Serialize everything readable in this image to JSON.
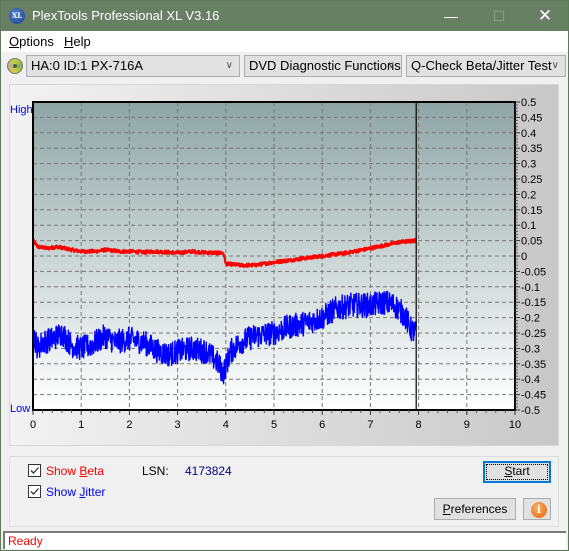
{
  "window": {
    "title": "PlexTools Professional XL V3.16",
    "app_icon_text": "XL",
    "minimize_glyph": "—",
    "maximize_glyph": "☐",
    "close_glyph": "✕"
  },
  "menu": [
    {
      "label_pre": "",
      "accel": "O",
      "label_post": "ptions"
    },
    {
      "label_pre": "",
      "accel": "H",
      "label_post": "elp"
    }
  ],
  "toolbar": {
    "drive": "HA:0 ID:1  PX-716A",
    "function": "DVD Diagnostic Functions",
    "test": "Q-Check Beta/Jitter Test",
    "chevron": "∨"
  },
  "chart_data": {
    "type": "line",
    "title": "",
    "xlabel": "",
    "ylabel_left_high": "High",
    "ylabel_left_low": "Low",
    "xlim": [
      0,
      10
    ],
    "ylim": [
      -0.5,
      0.5
    ],
    "x_ticks": [
      "0",
      "1",
      "2",
      "3",
      "4",
      "5",
      "6",
      "7",
      "8",
      "9",
      "10"
    ],
    "y_ticks": [
      "0.5",
      "0.45",
      "0.4",
      "0.35",
      "0.3",
      "0.25",
      "0.2",
      "0.15",
      "0.1",
      "0.05",
      "0",
      "-0.05",
      "-0.1",
      "-0.15",
      "-0.2",
      "-0.25",
      "-0.3",
      "-0.35",
      "-0.4",
      "-0.45",
      "-0.5"
    ],
    "grid": true,
    "end_marker_x": 7.95,
    "series": [
      {
        "name": "Beta",
        "color": "#ff0000",
        "x": [
          0,
          0.1,
          0.3,
          0.5,
          0.8,
          1.0,
          1.3,
          1.5,
          1.8,
          2.0,
          2.3,
          2.5,
          2.8,
          3.0,
          3.3,
          3.5,
          3.8,
          3.95,
          4.0,
          4.3,
          4.6,
          5.0,
          5.5,
          6.0,
          6.5,
          7.0,
          7.3,
          7.6,
          7.95
        ],
        "y": [
          0.05,
          0.03,
          0.025,
          0.03,
          0.02,
          0.015,
          0.015,
          0.02,
          0.015,
          0.015,
          0.012,
          0.015,
          0.012,
          0.01,
          0.015,
          0.012,
          0.01,
          0.01,
          -0.025,
          -0.03,
          -0.03,
          -0.02,
          -0.01,
          0.0,
          0.01,
          0.025,
          0.035,
          0.045,
          0.05
        ]
      },
      {
        "name": "Jitter",
        "color": "#0000ff",
        "x": [
          0,
          0.1,
          0.2,
          0.4,
          0.6,
          0.8,
          1.0,
          1.2,
          1.5,
          1.7,
          2.0,
          2.3,
          2.6,
          2.8,
          3.0,
          3.3,
          3.6,
          3.8,
          3.95,
          4.1,
          4.3,
          4.6,
          5.0,
          5.3,
          5.6,
          6.0,
          6.3,
          6.6,
          7.0,
          7.3,
          7.5,
          7.7,
          7.85,
          7.95
        ],
        "y": [
          -0.25,
          -0.3,
          -0.28,
          -0.27,
          -0.25,
          -0.29,
          -0.3,
          -0.29,
          -0.26,
          -0.28,
          -0.27,
          -0.28,
          -0.31,
          -0.32,
          -0.31,
          -0.3,
          -0.31,
          -0.34,
          -0.38,
          -0.31,
          -0.28,
          -0.26,
          -0.25,
          -0.23,
          -0.22,
          -0.2,
          -0.17,
          -0.16,
          -0.16,
          -0.15,
          -0.16,
          -0.19,
          -0.24,
          -0.25
        ],
        "noise_amplitude": 0.04
      }
    ]
  },
  "controls": {
    "show_beta_pre": "Show ",
    "show_beta_accel": "B",
    "show_beta_post": "eta",
    "show_beta_checked": true,
    "show_jitter_pre": "Show ",
    "show_jitter_accel": "J",
    "show_jitter_post": "itter",
    "show_jitter_checked": true,
    "lsn_label": "LSN:",
    "lsn_value": "4173824",
    "start_accel": "S",
    "start_post": "tart",
    "preferences_accel": "P",
    "preferences_post": "references",
    "info_glyph": "i"
  },
  "status": {
    "text": "Ready"
  }
}
